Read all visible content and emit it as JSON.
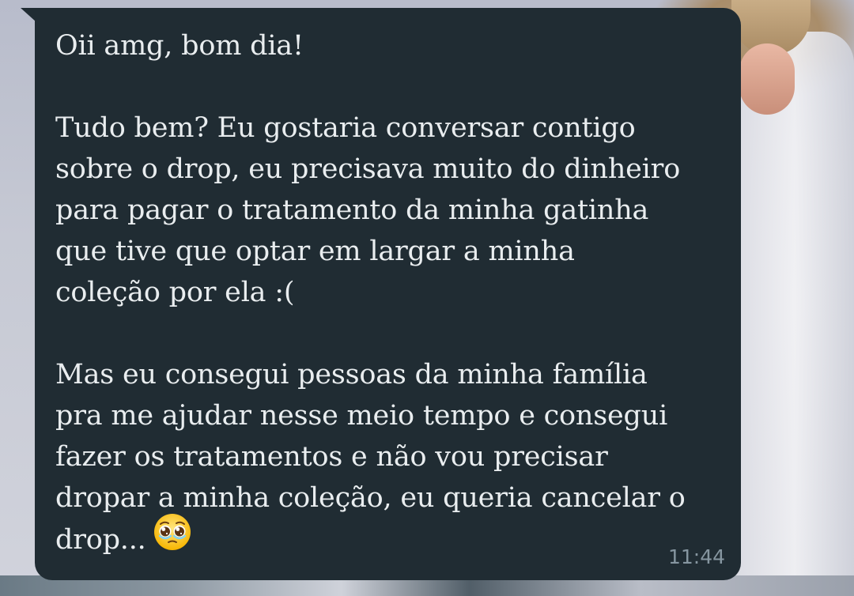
{
  "message": {
    "lines": [
      "Oii amg, bom dia!",
      "",
      "Tudo bem? Eu gostaria conversar contigo",
      "sobre o drop, eu precisava muito do dinheiro",
      "para pagar o tratamento da minha gatinha",
      "que tive que optar em largar a minha",
      "coleção por ela :(",
      "",
      "Mas eu consegui pessoas da minha família",
      "pra me ajudar nesse meio tempo e consegui",
      "fazer os tratamentos e não vou precisar",
      "dropar a minha coleção, eu queria cancelar o",
      "drop..."
    ],
    "emoji_icon": "pleading-face-emoji",
    "time": "11:44"
  },
  "colors": {
    "bubble": "#202c33",
    "text": "#e9edef",
    "timestamp": "#8696a0"
  }
}
